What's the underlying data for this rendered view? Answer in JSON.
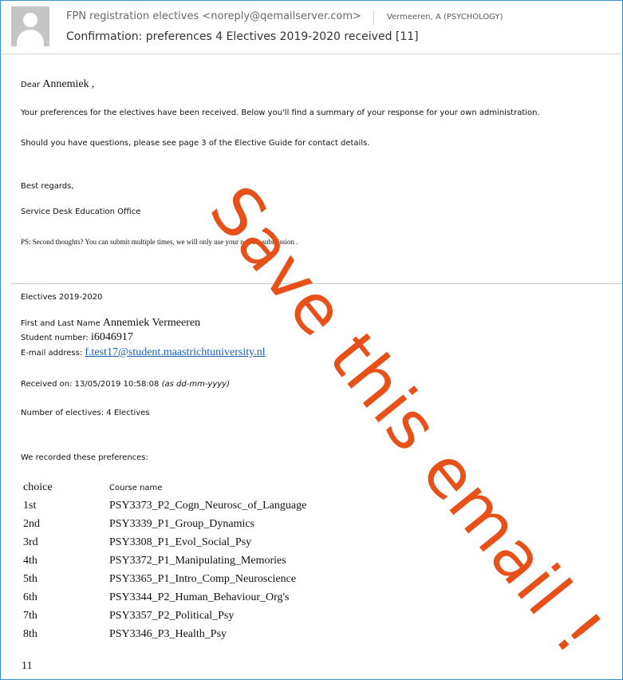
{
  "header": {
    "from": "FPN registration electives <noreply@qemailserver.com>",
    "to": "Vermeeren, A (PSYCHOLOGY)",
    "subject": "Confirmation: preferences 4 Electives 2019-2020 received [11]"
  },
  "body": {
    "greeting_prefix": "Dear",
    "greeting_name": "Annemiek",
    "greeting_suffix": ",",
    "line1": "Your preferences for the electives have been received. Below you'll find a summary of your response for your own administration.",
    "line2": "Should you have questions, please see page 3 of the Elective Guide for contact details.",
    "regards": "Best regards,",
    "office": "Service Desk Education Office",
    "ps": "PS: Second thoughts? You can submit multiple times, we will only use your newest submission ."
  },
  "summary": {
    "section_title": "Electives 2019-2020",
    "name_label": "First and Last Name",
    "name_value": "Annemiek Vermeeren",
    "student_label": "Student number:",
    "student_value": "i6046917",
    "email_label": "E-mail address:",
    "email_value": "f.test17@student.maastrichtuniversity.nl",
    "received_label": "Received on: 13/05/2019 10:58:08",
    "received_note": "(as dd-mm-yyyy)",
    "count_label": "Number of electives: 4 Electives",
    "recorded": "We recorded these preferences:"
  },
  "preferences": {
    "col_choice": "choice",
    "col_course": "Course name",
    "rows": [
      {
        "choice": "1st",
        "course": "PSY3373_P2_Cogn_Neurosc_of_Language"
      },
      {
        "choice": "2nd",
        "course": "PSY3339_P1_Group_Dynamics"
      },
      {
        "choice": "3rd",
        "course": "PSY3308_P1_Evol_Social_Psy"
      },
      {
        "choice": "4th",
        "course": "PSY3372_P1_Manipulating_Memories"
      },
      {
        "choice": "5th",
        "course": "PSY3365_P1_Intro_Comp_Neuroscience"
      },
      {
        "choice": "6th",
        "course": "PSY3344_P2_Human_Behaviour_Org's"
      },
      {
        "choice": "7th",
        "course": "PSY3357_P2_Political_Psy"
      },
      {
        "choice": "8th",
        "course": "PSY3346_P3_Health_Psy"
      }
    ],
    "footer_number": "11"
  },
  "watermark": {
    "text": "Save this email !",
    "color": "#e8501a"
  },
  "icons": {
    "avatar": "default-user-avatar-icon"
  }
}
